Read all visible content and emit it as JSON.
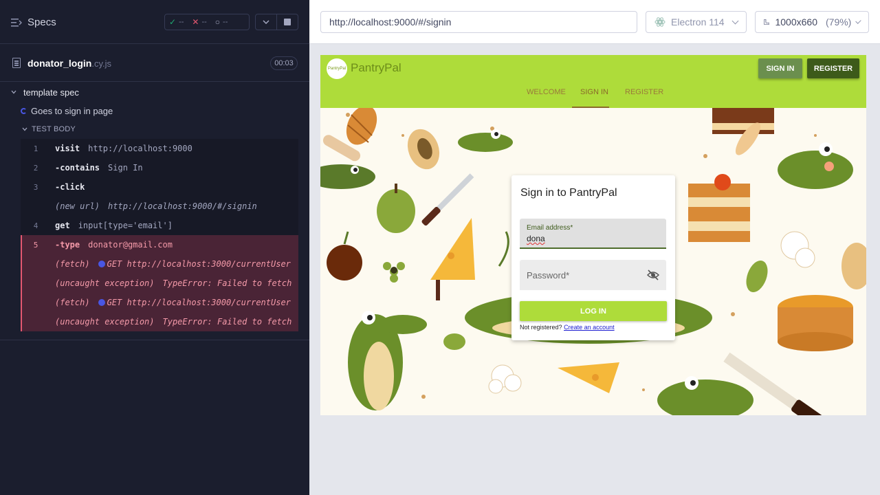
{
  "reporter": {
    "header_title": "Specs",
    "stats": {
      "passed": "--",
      "failed": "--",
      "pending": "--"
    },
    "spec_file": {
      "name": "donator_login",
      "ext": ".cy.js",
      "duration": "00:03"
    },
    "suite_title": "template spec",
    "test_title": "Goes to sign in page",
    "body_label": "TEST BODY",
    "commands": [
      {
        "num": "1",
        "name": "visit",
        "message": "http://localhost:9000"
      },
      {
        "num": "2",
        "name": "contains",
        "message": "Sign In"
      },
      {
        "num": "3",
        "name": "click",
        "message": ""
      },
      {
        "num": "",
        "name": "(new url)",
        "message": "http://localhost:9000/#/signin"
      },
      {
        "num": "4",
        "name": "get",
        "message": "input[type='email']"
      },
      {
        "num": "5",
        "name": "type",
        "message": "donator@gmail.com"
      },
      {
        "num": "",
        "name": "(fetch)",
        "message": "GET http://localhost:3000/currentUser"
      },
      {
        "num": "",
        "name": "(uncaught exception)",
        "message": "TypeError: Failed to fetch"
      },
      {
        "num": "",
        "name": "(fetch)",
        "message": "GET http://localhost:3000/currentUser"
      },
      {
        "num": "",
        "name": "(uncaught exception)",
        "message": "TypeError: Failed to fetch"
      }
    ]
  },
  "aut_header": {
    "url": "http://localhost:9000/#/signin",
    "browser": "Electron 114",
    "viewport": "1000x660",
    "zoom": "(79%)"
  },
  "app": {
    "brand": "PantryPal",
    "logo_text": "PantryPal",
    "btn_signin": "SIGN IN",
    "btn_register": "REGISTER",
    "tabs": [
      "WELCOME",
      "SIGN IN",
      "REGISTER"
    ],
    "login": {
      "title": "Sign in to PantryPal",
      "email_label": "Email address*",
      "email_value": "dona",
      "password_label": "Password*",
      "login_button": "LOG IN",
      "note_text": "Not registered?",
      "note_link": "Create an account"
    }
  },
  "colors": {
    "reporter_bg": "#1b1e2e",
    "error_bg": "#4a2436",
    "app_green": "#aedc3a",
    "register_dark": "#3d5a1a"
  }
}
